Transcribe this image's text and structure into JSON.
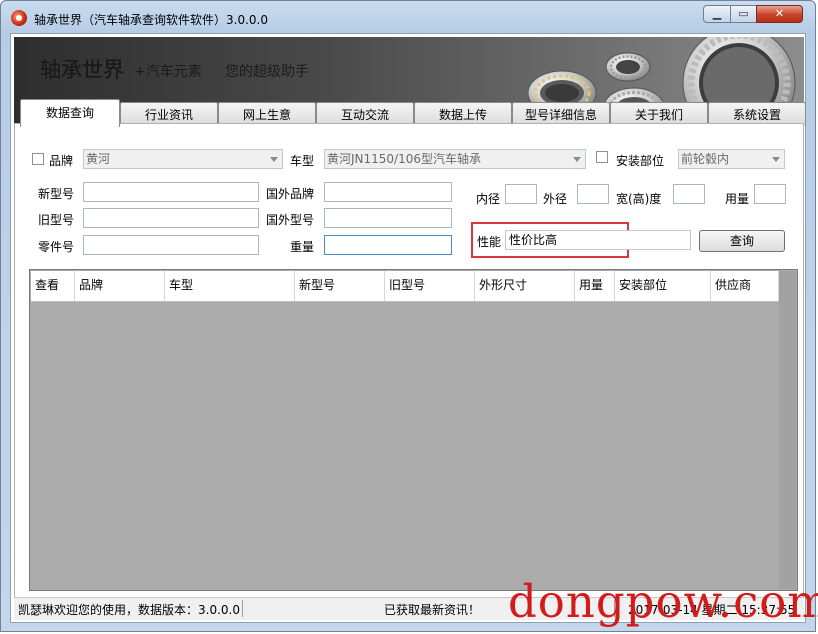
{
  "window": {
    "title": "轴承世界（汽车轴承查询软件软件）3.0.0.0",
    "min_glyph": "▁",
    "max_glyph": "▭",
    "close_glyph": "✕"
  },
  "banner": {
    "brand_main": "轴承世界",
    "brand_sub": "+汽车元素",
    "slogan": "您的超级助手"
  },
  "tabs": [
    {
      "label": "数据查询",
      "active": true
    },
    {
      "label": "行业资讯",
      "active": false
    },
    {
      "label": "网上生意",
      "active": false
    },
    {
      "label": "互动交流",
      "active": false
    },
    {
      "label": "数据上传",
      "active": false
    },
    {
      "label": "型号详细信息",
      "active": false
    },
    {
      "label": "关于我们",
      "active": false
    },
    {
      "label": "系统设置",
      "active": false
    }
  ],
  "form": {
    "brand_label": "品牌",
    "brand_value": "黄河",
    "car_model_label": "车型",
    "car_model_value": "黄河JN1150/106型汽车轴承",
    "install_label": "安装部位",
    "install_value": "前轮毂内",
    "new_model_label": "新型号",
    "old_model_label": "旧型号",
    "part_no_label": "零件号",
    "foreign_brand_label": "国外品牌",
    "foreign_model_label": "国外型号",
    "weight_label": "重量",
    "inner_label": "内径",
    "outer_label": "外径",
    "width_label": "宽(高)度",
    "usage_label": "用量",
    "perf_label": "性能",
    "perf_value": "性价比高",
    "query_button": "查询"
  },
  "grid": {
    "columns": [
      "查看",
      "品牌",
      "车型",
      "新型号",
      "旧型号",
      "外形尺寸",
      "用量",
      "安装部位",
      "供应商"
    ],
    "rows": []
  },
  "status": {
    "welcome": "凯瑟琳欢迎您的使用，数据版本：3.0.0.0",
    "message": "已获取最新资讯！",
    "datetime": "2017-03-14 星期二 15:37:55"
  },
  "watermark": "dongpow.com",
  "colors": {
    "highlight_border": "#d9363e",
    "grid_background": "#ababab",
    "watermark": "#d21b1b"
  }
}
